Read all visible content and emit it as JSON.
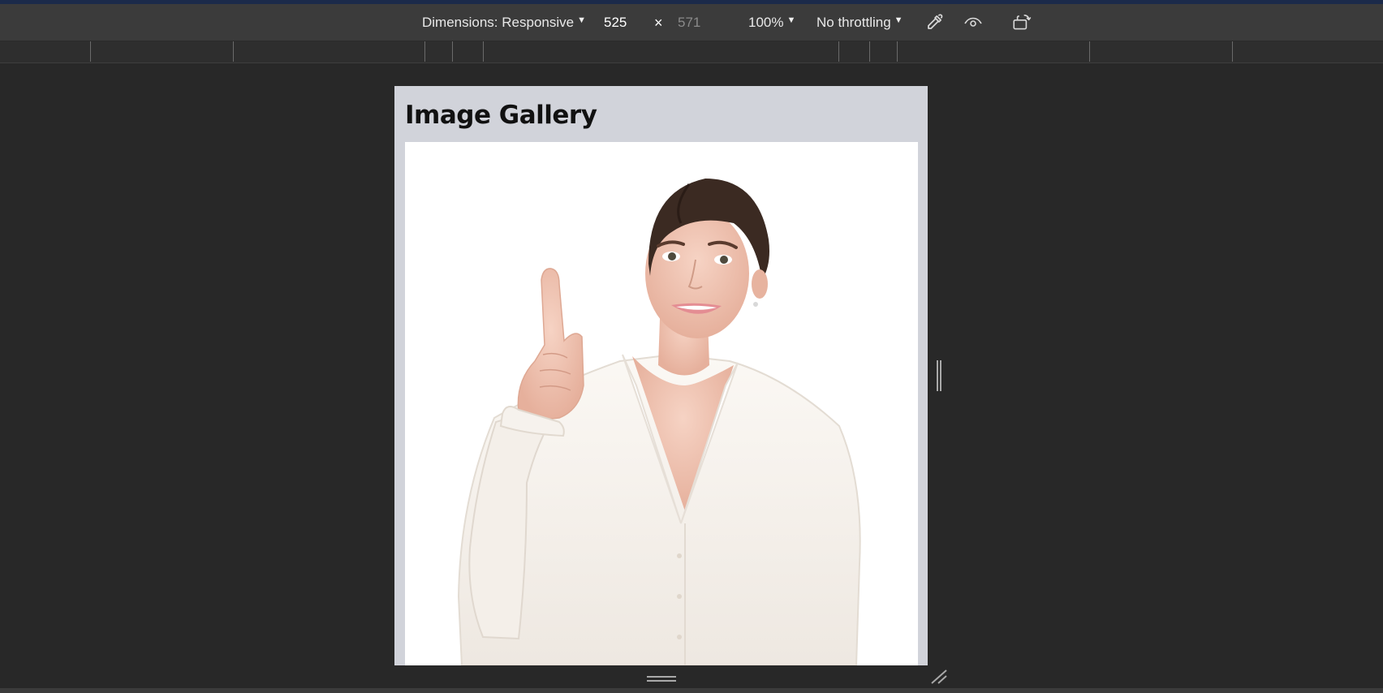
{
  "toolbar": {
    "dimensions_label": "Dimensions: Responsive",
    "width_value": "525",
    "times_symbol": "×",
    "height_value": "571",
    "zoom_label": "100%",
    "throttling_label": "No throttling",
    "icons": [
      "eyedropper-icon",
      "eye-icon",
      "rotate-device-icon"
    ]
  },
  "page": {
    "title": "Image Gallery",
    "image_alt": "Smiling woman in white blouse pointing finger up"
  },
  "colors": {
    "devtools_bg": "#282828",
    "toolbar_bg": "#3b3b3b",
    "viewport_bg": "#d1d3da",
    "accent_line": "#1b2a4a"
  }
}
